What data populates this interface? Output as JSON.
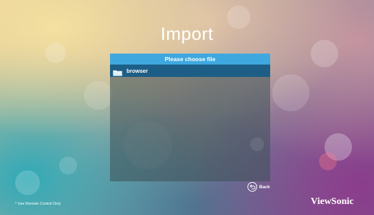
{
  "screen": {
    "title": "Import",
    "dialog_header": "Please choose file",
    "files": [
      {
        "label": "browser",
        "icon": "folder-icon",
        "selected": true
      }
    ],
    "back_label": "Back",
    "footnote": "* Use Remote Control Only",
    "brand": "ViewSonic"
  },
  "colors": {
    "header_bar": "#3ea8df",
    "selected_row": "#1d5e86",
    "text": "#ffffff"
  }
}
